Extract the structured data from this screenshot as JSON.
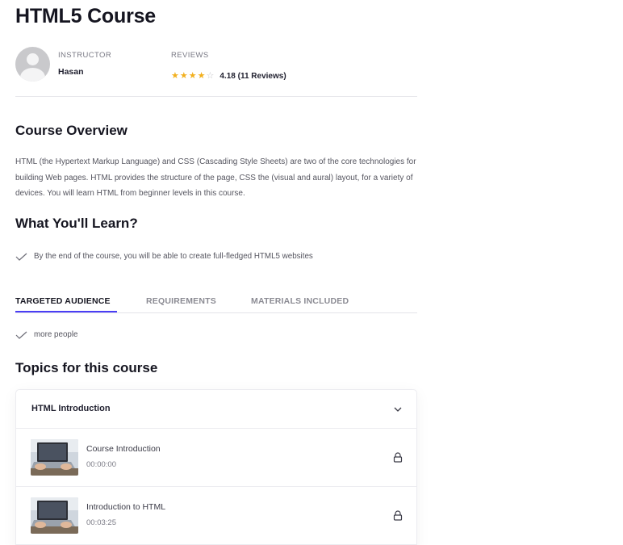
{
  "course": {
    "title": "HTML5 Course"
  },
  "meta": {
    "instructor_label": "INSTRUCTOR",
    "instructor_name": "Hasan",
    "reviews_label": "REVIEWS",
    "rating_stars": 4,
    "rating_max": 5,
    "rating_text": "4.18 (11 Reviews)"
  },
  "overview": {
    "title": "Course Overview",
    "text": "HTML (the Hypertext Markup Language) and CSS (Cascading Style Sheets) are two of the core technologies for building Web pages. HTML provides the structure of the page, CSS the (visual and aural) layout, for a variety of devices. You will learn HTML  from beginner levels in this course."
  },
  "learn": {
    "title": "What You'll Learn?",
    "items": [
      "By the end of the course, you will be able to create full-fledged HTML5 websites"
    ]
  },
  "tabs": [
    {
      "label": "TARGETED AUDIENCE",
      "active": true
    },
    {
      "label": "REQUIREMENTS",
      "active": false
    },
    {
      "label": "MATERIALS INCLUDED",
      "active": false
    }
  ],
  "audience": {
    "items": [
      "more people"
    ]
  },
  "topics": {
    "title": "Topics for this course",
    "sections": [
      {
        "title": "HTML Introduction",
        "lessons": [
          {
            "name": "Course Introduction",
            "duration": "00:00:00",
            "icon": "lock-icon"
          },
          {
            "name": "Introduction to HTML",
            "duration": "00:03:25",
            "icon": "lock-icon"
          }
        ]
      }
    ]
  },
  "colors": {
    "accent": "#4a3df5",
    "star": "#f2b01e",
    "text": "#1f1f2e",
    "muted": "#55555f"
  }
}
